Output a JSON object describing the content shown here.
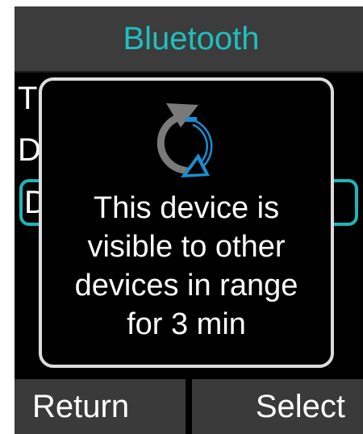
{
  "header": {
    "title": "Bluetooth",
    "title_color": "#1fbfc0"
  },
  "menu": {
    "items": [
      {
        "label": "T"
      },
      {
        "label": "D"
      },
      {
        "label": "D",
        "selected": true
      }
    ],
    "selection_color": "#1fb5b8"
  },
  "popup": {
    "icon": "bluetooth-visibility-refresh-icon",
    "message_lines": [
      "This device is",
      "visible to other",
      "devices in range",
      "for 3 min"
    ]
  },
  "softkeys": {
    "left_label": "Return",
    "right_label": "Select"
  }
}
